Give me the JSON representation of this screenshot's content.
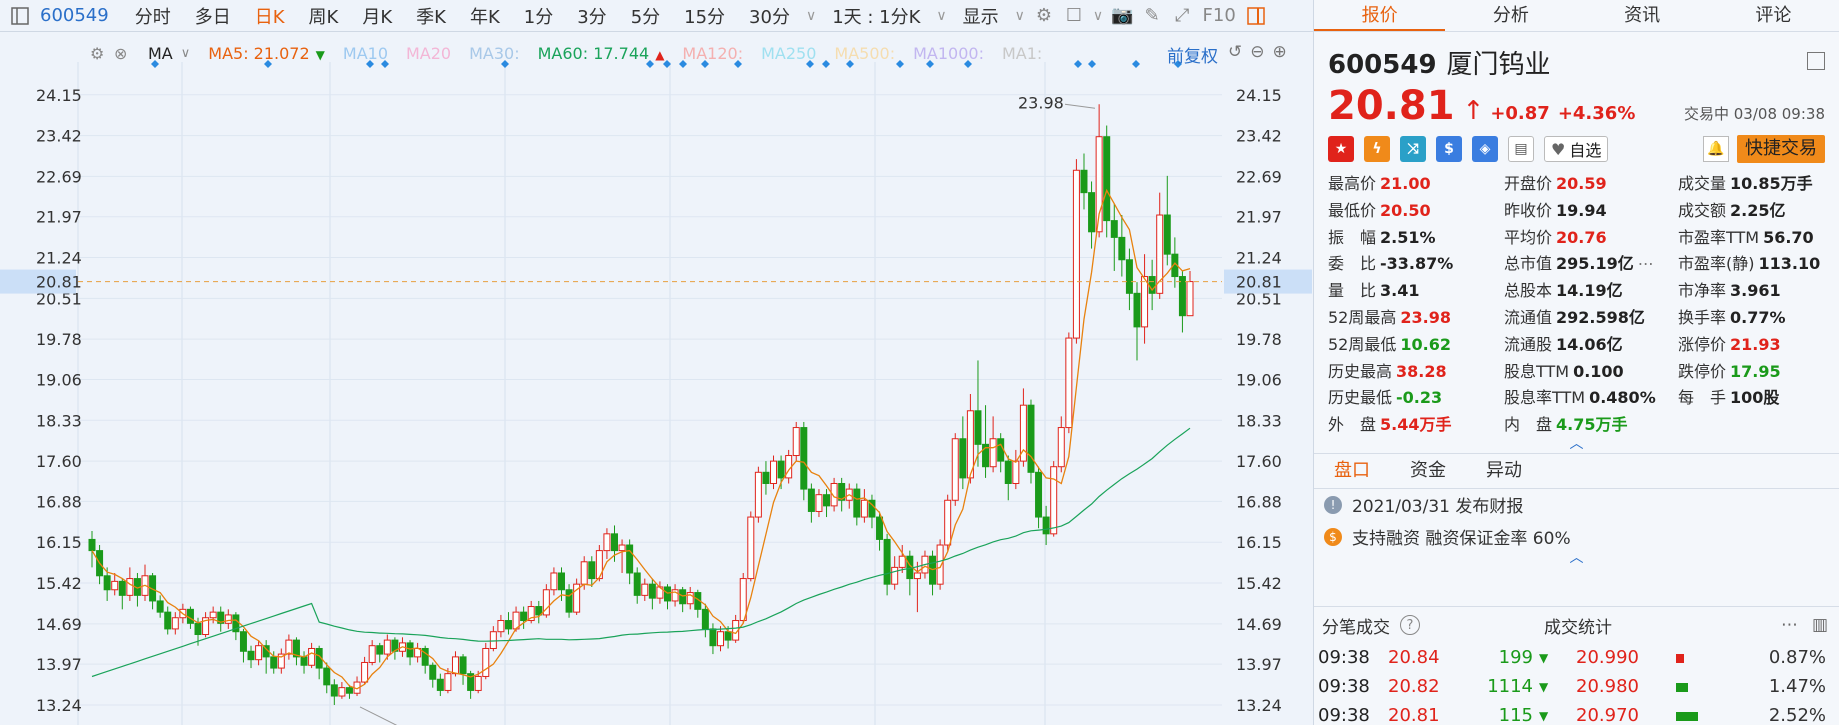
{
  "toolbar": {
    "code": "600549",
    "timeframes": [
      "分时",
      "多日",
      "日K",
      "周K",
      "月K",
      "季K",
      "年K",
      "1分",
      "3分",
      "5分",
      "15分",
      "30分"
    ],
    "active_timeframe": "日K",
    "interval": "1天 : 1分K",
    "display": "显示",
    "f10": "F10"
  },
  "ma_legend": {
    "label": "MA",
    "items": [
      {
        "text": "MA5: 21.072",
        "color": "#e8620f",
        "marker": "▼",
        "marker_color": "#1a9a1a"
      },
      {
        "text": "MA10",
        "color": "#9ec9f0"
      },
      {
        "text": "MA20",
        "color": "#f3b6d6"
      },
      {
        "text": "MA30:",
        "color": "#a8c8e8"
      },
      {
        "text": "MA60: 17.744",
        "color": "#1aa35a",
        "marker": "▲",
        "marker_color": "#e0231b"
      },
      {
        "text": "MA120:",
        "color": "#f4b0b0"
      },
      {
        "text": "MA250",
        "color": "#9fe0f0"
      },
      {
        "text": "MA500:",
        "color": "#f5ddb0"
      },
      {
        "text": "MA1000:",
        "color": "#c2b6f0"
      },
      {
        "text": "MA1:",
        "color": "#c8c8c8"
      }
    ],
    "adjust": "前复权"
  },
  "y_axis": {
    "ticks": [
      "24.15",
      "23.42",
      "22.69",
      "21.97",
      "21.24",
      "20.51",
      "19.78",
      "19.06",
      "18.33",
      "17.60",
      "16.88",
      "16.15",
      "15.42",
      "14.69",
      "13.97",
      "13.24"
    ],
    "current": "20.81"
  },
  "chart_data": {
    "type": "candlestick",
    "annotations": {
      "high": "23.98",
      "low": "13.24"
    },
    "ma5_last": 21.072,
    "ma60_last": 17.744,
    "current_price": 20.81,
    "ylim": [
      12.9,
      24.7
    ],
    "candles": [
      [
        16.2,
        16.0,
        15.7,
        16.35
      ],
      [
        16.0,
        15.55,
        15.4,
        16.1
      ],
      [
        15.55,
        15.3,
        15.1,
        15.7
      ],
      [
        15.3,
        15.45,
        15.2,
        15.6
      ],
      [
        15.45,
        15.2,
        14.95,
        15.5
      ],
      [
        15.2,
        15.5,
        15.1,
        15.7
      ],
      [
        15.5,
        15.2,
        15.0,
        15.6
      ],
      [
        15.2,
        15.55,
        15.1,
        15.75
      ],
      [
        15.55,
        15.1,
        14.95,
        15.6
      ],
      [
        15.1,
        14.9,
        14.8,
        15.2
      ],
      [
        14.9,
        14.6,
        14.5,
        15.0
      ],
      [
        14.6,
        14.8,
        14.5,
        14.9
      ],
      [
        14.8,
        14.95,
        14.7,
        15.05
      ],
      [
        14.95,
        14.7,
        14.6,
        15.0
      ],
      [
        14.7,
        14.5,
        14.3,
        14.8
      ],
      [
        14.5,
        14.8,
        14.45,
        14.9
      ],
      [
        14.8,
        14.9,
        14.7,
        15.0
      ],
      [
        14.9,
        14.7,
        14.55,
        15.0
      ],
      [
        14.7,
        14.85,
        14.6,
        14.95
      ],
      [
        14.85,
        14.55,
        14.4,
        14.9
      ],
      [
        14.55,
        14.2,
        14.0,
        14.6
      ],
      [
        14.2,
        14.05,
        13.9,
        14.3
      ],
      [
        14.05,
        14.3,
        13.95,
        14.4
      ],
      [
        14.3,
        14.1,
        13.8,
        14.4
      ],
      [
        14.1,
        13.9,
        13.8,
        14.2
      ],
      [
        13.9,
        14.15,
        13.8,
        14.25
      ],
      [
        14.15,
        14.4,
        14.05,
        14.5
      ],
      [
        14.4,
        14.1,
        13.95,
        14.45
      ],
      [
        14.1,
        13.95,
        13.8,
        14.2
      ],
      [
        13.95,
        14.25,
        13.9,
        14.35
      ],
      [
        14.25,
        13.9,
        13.7,
        14.3
      ],
      [
        13.9,
        13.6,
        13.45,
        14.0
      ],
      [
        13.6,
        13.4,
        13.24,
        13.7
      ],
      [
        13.4,
        13.55,
        13.35,
        13.65
      ],
      [
        13.55,
        13.45,
        13.35,
        13.6
      ],
      [
        13.45,
        13.65,
        13.4,
        13.75
      ],
      [
        13.65,
        14.0,
        13.6,
        14.1
      ],
      [
        14.0,
        14.3,
        13.95,
        14.4
      ],
      [
        14.3,
        14.15,
        14.0,
        14.35
      ],
      [
        14.15,
        14.4,
        14.05,
        14.5
      ],
      [
        14.4,
        14.2,
        14.05,
        14.45
      ],
      [
        14.2,
        14.35,
        14.1,
        14.45
      ],
      [
        14.35,
        14.1,
        13.95,
        14.4
      ],
      [
        14.1,
        14.25,
        14.0,
        14.35
      ],
      [
        14.25,
        13.95,
        13.8,
        14.3
      ],
      [
        13.95,
        13.7,
        13.55,
        14.0
      ],
      [
        13.7,
        13.5,
        13.4,
        13.8
      ],
      [
        13.5,
        13.8,
        13.45,
        13.9
      ],
      [
        13.8,
        14.1,
        13.75,
        14.2
      ],
      [
        14.1,
        13.8,
        13.6,
        14.15
      ],
      [
        13.8,
        13.5,
        13.35,
        13.85
      ],
      [
        13.5,
        13.75,
        13.45,
        13.85
      ],
      [
        13.75,
        14.25,
        13.7,
        14.35
      ],
      [
        14.25,
        14.55,
        14.2,
        14.65
      ],
      [
        14.55,
        14.75,
        14.45,
        14.85
      ],
      [
        14.75,
        14.6,
        14.5,
        14.9
      ],
      [
        14.6,
        14.9,
        14.55,
        15.0
      ],
      [
        14.9,
        14.75,
        14.6,
        15.0
      ],
      [
        14.75,
        15.0,
        14.7,
        15.1
      ],
      [
        15.0,
        14.85,
        14.7,
        15.1
      ],
      [
        14.85,
        15.3,
        14.8,
        15.4
      ],
      [
        15.3,
        15.6,
        15.2,
        15.7
      ],
      [
        15.6,
        15.3,
        15.1,
        15.7
      ],
      [
        15.3,
        14.9,
        14.8,
        15.4
      ],
      [
        14.9,
        15.4,
        14.85,
        15.5
      ],
      [
        15.4,
        15.8,
        15.3,
        15.9
      ],
      [
        15.8,
        15.5,
        15.35,
        15.9
      ],
      [
        15.5,
        16.0,
        15.45,
        16.1
      ],
      [
        16.0,
        16.3,
        15.85,
        16.4
      ],
      [
        16.3,
        16.0,
        15.8,
        16.45
      ],
      [
        16.0,
        16.1,
        15.6,
        16.2
      ],
      [
        16.1,
        15.6,
        15.4,
        16.2
      ],
      [
        15.6,
        15.2,
        15.05,
        15.7
      ],
      [
        15.2,
        15.4,
        15.1,
        15.5
      ],
      [
        15.4,
        15.15,
        14.95,
        15.5
      ],
      [
        15.15,
        15.35,
        15.05,
        15.45
      ],
      [
        15.35,
        15.1,
        14.95,
        15.4
      ],
      [
        15.1,
        15.3,
        15.0,
        15.4
      ],
      [
        15.3,
        15.05,
        14.9,
        15.35
      ],
      [
        15.05,
        15.25,
        14.95,
        15.35
      ],
      [
        15.25,
        14.95,
        14.8,
        15.3
      ],
      [
        14.95,
        14.6,
        14.45,
        15.05
      ],
      [
        14.6,
        14.3,
        14.15,
        14.7
      ],
      [
        14.3,
        14.55,
        14.2,
        14.65
      ],
      [
        14.55,
        14.4,
        14.25,
        14.65
      ],
      [
        14.4,
        14.75,
        14.35,
        14.85
      ],
      [
        14.75,
        15.5,
        14.7,
        15.6
      ],
      [
        15.5,
        16.6,
        15.45,
        16.7
      ],
      [
        16.6,
        17.4,
        16.5,
        17.5
      ],
      [
        17.4,
        17.2,
        17.0,
        17.6
      ],
      [
        17.2,
        17.6,
        17.1,
        17.7
      ],
      [
        17.6,
        17.3,
        17.1,
        17.7
      ],
      [
        17.3,
        17.7,
        17.2,
        17.8
      ],
      [
        17.7,
        18.2,
        17.6,
        18.3
      ],
      [
        18.2,
        17.1,
        16.9,
        18.3
      ],
      [
        17.1,
        16.7,
        16.5,
        17.2
      ],
      [
        16.7,
        17.0,
        16.6,
        17.1
      ],
      [
        17.0,
        16.8,
        16.6,
        17.1
      ],
      [
        16.8,
        17.2,
        16.7,
        17.3
      ],
      [
        17.2,
        16.9,
        16.7,
        17.3
      ],
      [
        16.9,
        17.1,
        16.75,
        17.2
      ],
      [
        17.1,
        16.6,
        16.45,
        17.2
      ],
      [
        16.6,
        16.9,
        16.5,
        17.1
      ],
      [
        16.9,
        16.6,
        16.4,
        17.0
      ],
      [
        16.6,
        16.2,
        16.0,
        16.7
      ],
      [
        16.2,
        15.4,
        15.2,
        16.3
      ],
      [
        15.4,
        15.7,
        15.3,
        15.9
      ],
      [
        15.7,
        15.9,
        15.6,
        16.1
      ],
      [
        15.9,
        15.5,
        15.2,
        16.0
      ],
      [
        15.5,
        15.6,
        14.9,
        15.8
      ],
      [
        15.6,
        15.9,
        15.5,
        16.0
      ],
      [
        15.9,
        15.4,
        15.2,
        16.0
      ],
      [
        15.4,
        16.1,
        15.3,
        16.2
      ],
      [
        16.1,
        16.9,
        16.0,
        17.0
      ],
      [
        16.9,
        18.0,
        16.8,
        18.1
      ],
      [
        18.0,
        17.3,
        17.1,
        18.4
      ],
      [
        17.3,
        18.5,
        17.2,
        18.8
      ],
      [
        18.5,
        17.9,
        17.5,
        19.4
      ],
      [
        17.9,
        17.5,
        17.3,
        18.6
      ],
      [
        17.5,
        18.0,
        17.4,
        18.4
      ],
      [
        18.0,
        17.6,
        17.4,
        18.1
      ],
      [
        17.6,
        17.2,
        16.9,
        17.7
      ],
      [
        17.2,
        17.6,
        17.1,
        17.8
      ],
      [
        17.6,
        18.6,
        17.5,
        18.9
      ],
      [
        18.6,
        17.4,
        17.2,
        18.7
      ],
      [
        17.4,
        16.6,
        16.4,
        17.5
      ],
      [
        16.6,
        16.3,
        16.1,
        16.8
      ],
      [
        16.3,
        17.5,
        16.25,
        17.6
      ],
      [
        17.5,
        18.2,
        17.4,
        18.4
      ],
      [
        18.2,
        19.8,
        18.1,
        19.9
      ],
      [
        19.8,
        22.8,
        19.7,
        23.0
      ],
      [
        22.8,
        22.4,
        22.1,
        23.1
      ],
      [
        22.4,
        21.7,
        21.4,
        22.6
      ],
      [
        21.7,
        23.4,
        21.6,
        23.98
      ],
      [
        23.4,
        21.9,
        21.6,
        23.6
      ],
      [
        21.9,
        21.6,
        21.0,
        22.2
      ],
      [
        21.6,
        21.2,
        20.9,
        22.0
      ],
      [
        21.2,
        20.6,
        20.3,
        21.4
      ],
      [
        20.6,
        20.0,
        19.4,
        20.8
      ],
      [
        20.0,
        20.9,
        19.7,
        21.3
      ],
      [
        20.9,
        20.6,
        20.3,
        21.2
      ],
      [
        20.6,
        22.0,
        20.5,
        22.4
      ],
      [
        22.0,
        21.3,
        21.1,
        22.7
      ],
      [
        21.3,
        20.9,
        20.7,
        21.6
      ],
      [
        20.9,
        20.2,
        19.9,
        21.0
      ],
      [
        20.2,
        20.81,
        20.3,
        21.0
      ]
    ]
  },
  "panel": {
    "tabs": [
      "报价",
      "分析",
      "资讯",
      "评论"
    ],
    "active_tab": "报价",
    "code": "600549",
    "name": "厦门钨业",
    "price": "20.81",
    "change": "+0.87",
    "change_pct": "+4.36%",
    "status_time": "交易中 03/08 09:38",
    "zixuan": "自选",
    "quick_trade": "快捷交易",
    "stats": [
      {
        "k": "最高价",
        "v": "21.00",
        "c": "red"
      },
      {
        "k": "开盘价",
        "v": "20.59",
        "c": "red"
      },
      {
        "k": "成交量",
        "v": "10.85万手",
        "c": "dark"
      },
      {
        "k": "最低价",
        "v": "20.50",
        "c": "red"
      },
      {
        "k": "昨收价",
        "v": "19.94",
        "c": "dark"
      },
      {
        "k": "成交额",
        "v": "2.25亿",
        "c": "dark"
      },
      {
        "k": "振　幅",
        "v": "2.51%",
        "c": "dark"
      },
      {
        "k": "平均价",
        "v": "20.76",
        "c": "red"
      },
      {
        "k": "市盈率TTM",
        "v": "56.70",
        "c": "dark"
      },
      {
        "k": "委　比",
        "v": "-33.87%",
        "c": "dark"
      },
      {
        "k": "总市值",
        "v": "295.19亿",
        "c": "dark"
      },
      {
        "k": "市盈率(静)",
        "v": "113.10",
        "c": "dark"
      },
      {
        "k": "量　比",
        "v": "3.41",
        "c": "dark"
      },
      {
        "k": "总股本",
        "v": "14.19亿",
        "c": "dark"
      },
      {
        "k": "市净率",
        "v": "3.961",
        "c": "dark"
      },
      {
        "k": "52周最高",
        "v": "23.98",
        "c": "red"
      },
      {
        "k": "流通值",
        "v": "292.598亿",
        "c": "dark"
      },
      {
        "k": "换手率",
        "v": "0.77%",
        "c": "dark"
      },
      {
        "k": "52周最低",
        "v": "10.62",
        "c": "green"
      },
      {
        "k": "流通股",
        "v": "14.06亿",
        "c": "dark"
      },
      {
        "k": "涨停价",
        "v": "21.93",
        "c": "red"
      },
      {
        "k": "历史最高",
        "v": "38.28",
        "c": "red"
      },
      {
        "k": "股息TTM",
        "v": "0.100",
        "c": "dark"
      },
      {
        "k": "跌停价",
        "v": "17.95",
        "c": "green"
      },
      {
        "k": "历史最低",
        "v": "-0.23",
        "c": "green"
      },
      {
        "k": "股息率TTM",
        "v": "0.480%",
        "c": "dark"
      },
      {
        "k": "每　手",
        "v": "100股",
        "c": "dark"
      },
      {
        "k": "外　盘",
        "v": "5.44万手",
        "c": "red"
      },
      {
        "k": "内　盘",
        "v": "4.75万手",
        "c": "green"
      }
    ],
    "subtabs": [
      "盘口",
      "资金",
      "异动"
    ],
    "notices": [
      {
        "icon": "!",
        "color": "#8a9bb0",
        "text": "2021/03/31  发布财报"
      },
      {
        "icon": "$",
        "color": "#f08a1a",
        "text": "支持融资  融资保证金率 60%"
      }
    ],
    "bottom": {
      "left_title": "分笔成交",
      "right_title": "成交统计",
      "trades": [
        {
          "t": "09:38",
          "p": "20.84",
          "v": "199"
        },
        {
          "t": "09:38",
          "p": "20.82",
          "v": "1114"
        },
        {
          "t": "09:38",
          "p": "20.81",
          "v": "115"
        }
      ],
      "deals": [
        {
          "p": "20.990",
          "pct": "0.87%",
          "w": 8,
          "c": "#e0231b"
        },
        {
          "p": "20.980",
          "pct": "1.47%",
          "w": 12,
          "c": "#1a9a1a"
        },
        {
          "p": "20.970",
          "pct": "2.52%",
          "w": 22,
          "c": "#1a9a1a"
        }
      ]
    }
  }
}
